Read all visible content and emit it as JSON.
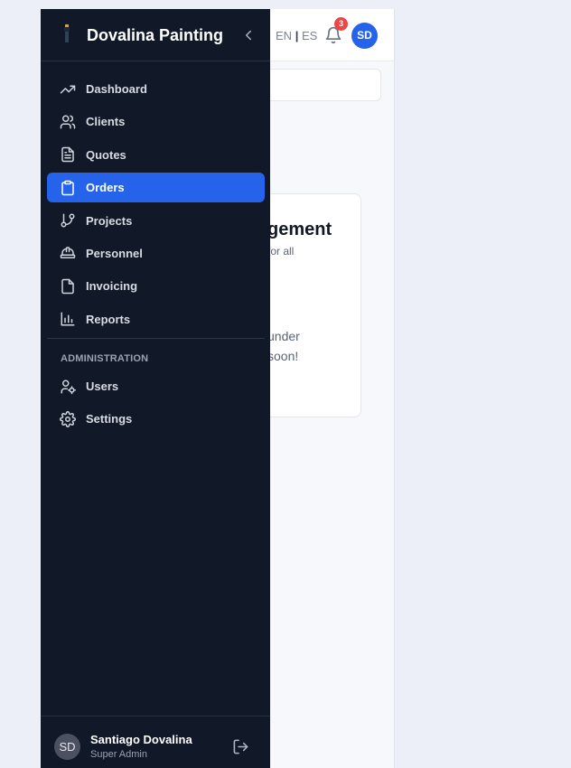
{
  "topbar": {
    "lang_en": "EN",
    "lang_sep": "|",
    "lang_es": "ES",
    "notifications_count": "3",
    "avatar_initials": "SD"
  },
  "main": {
    "card_title": "gement",
    "card_subtitle": "for all",
    "card_message_line1": "under",
    "card_message_line2": "soon!"
  },
  "sidebar": {
    "brand_name": "Dovalina Painting",
    "items": [
      {
        "label": "Dashboard",
        "icon": "trending-up-icon"
      },
      {
        "label": "Clients",
        "icon": "users-icon"
      },
      {
        "label": "Quotes",
        "icon": "file-text-icon"
      },
      {
        "label": "Orders",
        "icon": "clipboard-icon",
        "active": true
      },
      {
        "label": "Projects",
        "icon": "git-branch-icon"
      },
      {
        "label": "Personnel",
        "icon": "hard-hat-icon"
      },
      {
        "label": "Invoicing",
        "icon": "file-icon"
      },
      {
        "label": "Reports",
        "icon": "bar-chart-icon"
      }
    ],
    "admin_section_label": "ADMINISTRATION",
    "admin_items": [
      {
        "label": "Users",
        "icon": "user-cog-icon"
      },
      {
        "label": "Settings",
        "icon": "gear-icon"
      }
    ],
    "footer": {
      "avatar_initials": "SD",
      "user_name": "Santiago Dovalina",
      "user_role": "Super Admin"
    }
  },
  "colors": {
    "sidebar_bg": "#111827",
    "accent": "#2563eb",
    "badge": "#ef4444"
  }
}
